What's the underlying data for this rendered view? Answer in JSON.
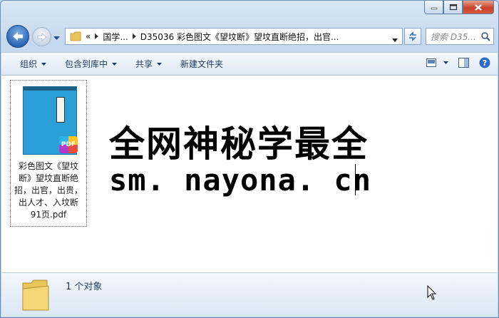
{
  "window": {
    "caption_buttons": [
      "minimize",
      "maximize",
      "close"
    ]
  },
  "nav": {
    "address": {
      "overflow_glyph": "«",
      "crumbs": [
        "国学...",
        "D35036 彩色图文《望坟断》望坟直断绝招，出官..."
      ]
    },
    "search_placeholder": "搜索 D35..."
  },
  "commandbar": {
    "organize": "组织",
    "include_library": "包含到库中",
    "share": "共享",
    "new_folder": "新建文件夹"
  },
  "content": {
    "file": {
      "name": "彩色图文《望坟断》望坟直断绝招，出官，出贵，出人才、入坟断91页.pdf",
      "name_lines": [
        "彩色图文《望坟",
        "断》望坟直断绝",
        "招，出官，出贵，",
        "出人才、入坟断",
        "91页.pdf"
      ],
      "badge": "PDF"
    },
    "banner": {
      "line1": "全网神秘学最全",
      "line2": "sm. nayona. cn"
    }
  },
  "details": {
    "count_text": "1 个对象"
  },
  "colors": {
    "accent": "#2b66b7",
    "cover": "#2a9fd8"
  }
}
